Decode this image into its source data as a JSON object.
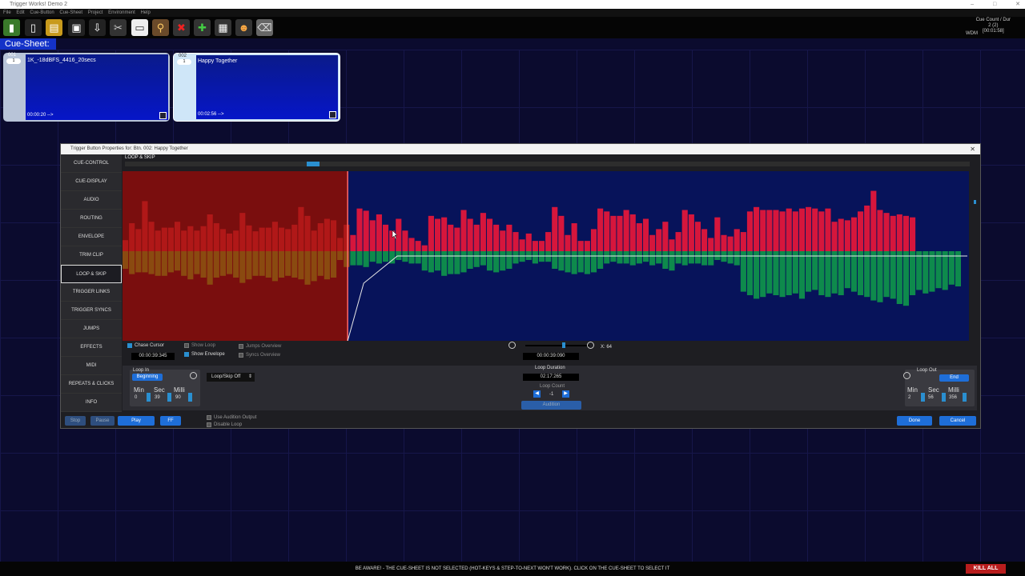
{
  "window": {
    "title": "Trigger Works! Demo 2",
    "controls": [
      "–",
      "□",
      "✕"
    ]
  },
  "menu": [
    "File",
    "Edit",
    "Cue-Button",
    "Cue-Sheet",
    "Project",
    "Environment",
    "Help"
  ],
  "toolbar": {
    "icons": [
      "book-icon",
      "new-page-icon",
      "notepad-icon",
      "save-icon",
      "export-icon",
      "scissors-icon",
      "paste-icon",
      "stamp-icon",
      "delete-icon",
      "add-film-icon",
      "clapper-icon",
      "add-users-icon",
      "trash-icon"
    ],
    "counter_label": "Cue Count / Dur",
    "counter_value": "2 (2)",
    "counter_time": "[00:01:58]",
    "driver": "WDM"
  },
  "cuesheet_tab": "Cue-Sheet: 1",
  "cues": [
    {
      "number": "001",
      "pill": "1",
      "name": "1K_-18dBFS_4416_20secs",
      "duration": "00:00:20 -->"
    },
    {
      "number": "002",
      "pill": "1",
      "name": "Happy Together",
      "duration": "00:02:56 -->"
    }
  ],
  "dialog": {
    "title": "Trigger Button Properties for:  Btn. 002: Happy Together",
    "close": "✕",
    "section": "LOOP & SKIP",
    "side_items": [
      "CUE-CONTROL",
      "CUE-DISPLAY",
      "AUDIO",
      "ROUTING",
      "ENVELOPE",
      "TRIM CLIP",
      "LOOP & SKIP",
      "TRIGGER LINKS",
      "TRIGGER SYNCS",
      "JUMPS",
      "EFFECTS",
      "MIDI",
      "REPEATS & CLICKS",
      "INFO"
    ],
    "active_item": "LOOP & SKIP",
    "checks": {
      "chase_cursor": "Chase Cursor",
      "show_loop": "Show Loop",
      "show_envelope": "Show Envelope",
      "jumps_overview": "Jumps Overview",
      "syncs_overview": "Syncs Overview"
    },
    "cursor_time": "00:00:39:345",
    "position_time": "00:00:39:090",
    "zoom_label": "X: 64",
    "loop_in": {
      "label": "Loop In",
      "button": "Beginning",
      "min_label": "Min",
      "sec_label": "Sec",
      "milli_label": "Milli",
      "min": "0",
      "sec": "39",
      "milli": "90"
    },
    "mode_select": "Loop/Skip Off",
    "loop_duration_label": "Loop Duration",
    "loop_duration": "02:17:265",
    "loop_count_label": "Loop Count",
    "loop_count": "-1",
    "audition": "Audition",
    "loop_out": {
      "label": "Loop Out",
      "button": "End",
      "min_label": "Min",
      "sec_label": "Sec",
      "milli_label": "Milli",
      "min": "2",
      "sec": "56",
      "milli": "356"
    },
    "transport": {
      "stop": "Stop",
      "pause": "Pause",
      "play": "Play",
      "ff": "FF"
    },
    "use_audition_output": "Use Audition Output",
    "disable_loop": "Disable Loop",
    "done": "Done",
    "cancel": "Cancel"
  },
  "status_bar": "BE AWARE! - THE CUE-SHEET IS NOT SELECTED (HOT-KEYS & STEP-TO-NEXT WON'T WORK). CLICK ON THE CUE-SHEET TO SELECT IT",
  "kill_all": "KILL ALL",
  "waveform": {
    "top": [
      0.15,
      0.38,
      0.3,
      0.68,
      0.4,
      0.28,
      0.32,
      0.32,
      0.4,
      0.28,
      0.34,
      0.28,
      0.34,
      0.5,
      0.38,
      0.3,
      0.24,
      0.28,
      0.52,
      0.35,
      0.27,
      0.32,
      0.32,
      0.4,
      0.32,
      0.3,
      0.36,
      0.6,
      0.48,
      0.28,
      0.38,
      0.44,
      0.42,
      0.18,
      0.36,
      0.22,
      0.58,
      0.55,
      0.42,
      0.5,
      0.36,
      0.28,
      0.44,
      0.28,
      0.18,
      0.14,
      0.08,
      0.48,
      0.44,
      0.46,
      0.36,
      0.32,
      0.56,
      0.44,
      0.36,
      0.52,
      0.44,
      0.36,
      0.28,
      0.36,
      0.26,
      0.16,
      0.24,
      0.14,
      0.14,
      0.26,
      0.6,
      0.48,
      0.22,
      0.38,
      0.14,
      0.14,
      0.3,
      0.58,
      0.54,
      0.48,
      0.48,
      0.56,
      0.5,
      0.38,
      0.44,
      0.22,
      0.3,
      0.4,
      0.16,
      0.26,
      0.56,
      0.5,
      0.4,
      0.3,
      0.18,
      0.46,
      0.22,
      0.2,
      0.3,
      0.26,
      0.54,
      0.6,
      0.56,
      0.56,
      0.56,
      0.54,
      0.58,
      0.54,
      0.58,
      0.6,
      0.58,
      0.54,
      0.58,
      0.4,
      0.44,
      0.42,
      0.46,
      0.54,
      0.62,
      0.82,
      0.56,
      0.52,
      0.48,
      0.5,
      0.48,
      0.46
    ],
    "bottom": [
      0.2,
      0.26,
      0.24,
      0.24,
      0.26,
      0.28,
      0.28,
      0.24,
      0.22,
      0.28,
      0.32,
      0.26,
      0.3,
      0.38,
      0.3,
      0.28,
      0.26,
      0.3,
      0.36,
      0.32,
      0.28,
      0.28,
      0.3,
      0.34,
      0.3,
      0.28,
      0.3,
      0.32,
      0.38,
      0.34,
      0.28,
      0.32,
      0.3,
      0.1,
      0.18,
      0.16,
      0.16,
      0.18,
      0.12,
      0.14,
      0.12,
      0.14,
      0.1,
      0.12,
      0.14,
      0.14,
      0.22,
      0.24,
      0.22,
      0.28,
      0.26,
      0.26,
      0.24,
      0.2,
      0.18,
      0.16,
      0.22,
      0.24,
      0.22,
      0.2,
      0.14,
      0.12,
      0.1,
      0.14,
      0.12,
      0.12,
      0.2,
      0.22,
      0.24,
      0.26,
      0.24,
      0.26,
      0.24,
      0.2,
      0.14,
      0.12,
      0.14,
      0.14,
      0.16,
      0.14,
      0.12,
      0.16,
      0.14,
      0.2,
      0.22,
      0.14,
      0.16,
      0.14,
      0.14,
      0.16,
      0.16,
      0.1,
      0.12,
      0.14,
      0.16,
      0.46,
      0.5,
      0.54,
      0.52,
      0.48,
      0.5,
      0.52,
      0.5,
      0.48,
      0.54,
      0.46,
      0.44,
      0.5,
      0.52,
      0.48,
      0.5,
      0.42,
      0.46,
      0.5,
      0.52,
      0.56,
      0.58,
      0.52,
      0.54,
      0.6,
      0.62,
      0.5,
      0.44,
      0.48,
      0.46,
      0.42,
      0.44,
      0.38,
      0.4
    ],
    "loop_in_fraction": 0.266,
    "colors": {
      "top": "#d6163c",
      "bottom": "#0e8a4c",
      "muted_top": "#b01818",
      "muted_bottom": "#8a4a10",
      "bg": "#07135a",
      "muted_bg": "#7a0e0e"
    }
  }
}
